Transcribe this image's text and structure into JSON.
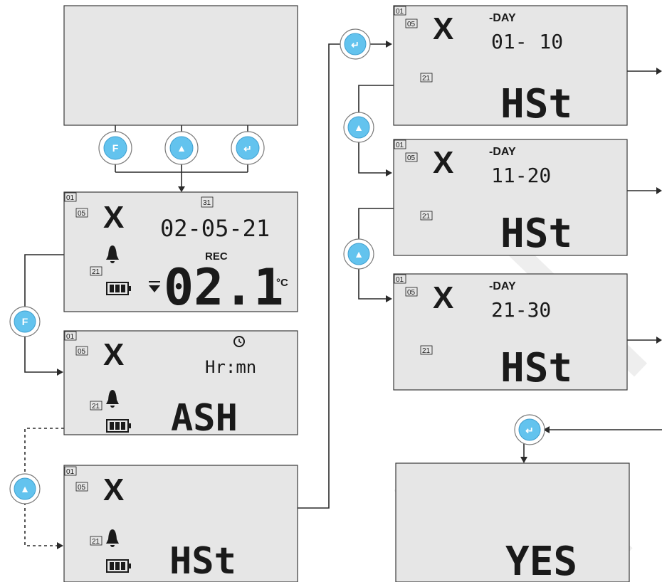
{
  "buttons": {
    "function": "F",
    "up": "▲",
    "enter": "↵"
  },
  "channel_tags": {
    "top": "01",
    "middle": "05",
    "bottom": "21"
  },
  "channel_mark": "X",
  "screens": {
    "main": {
      "date": "02-05-21",
      "rec_label": "REC",
      "calendar_day": "31",
      "reading": "02.1",
      "unit": "°C"
    },
    "alarm": {
      "time_label": "Hr:mn",
      "value": "ASH"
    },
    "history": {
      "value": "HSt"
    },
    "day_pages": [
      {
        "day_label": "-DAY",
        "range": "01- 10",
        "value": "HSt"
      },
      {
        "day_label": "-DAY",
        "range": "11-20",
        "value": "HSt"
      },
      {
        "day_label": "-DAY",
        "range": "21-30",
        "value": "HSt"
      }
    ],
    "confirm": {
      "value": "YES"
    }
  },
  "colors": {
    "button_fill": "#63c3ee",
    "lcd_background": "#e6e6e6"
  }
}
